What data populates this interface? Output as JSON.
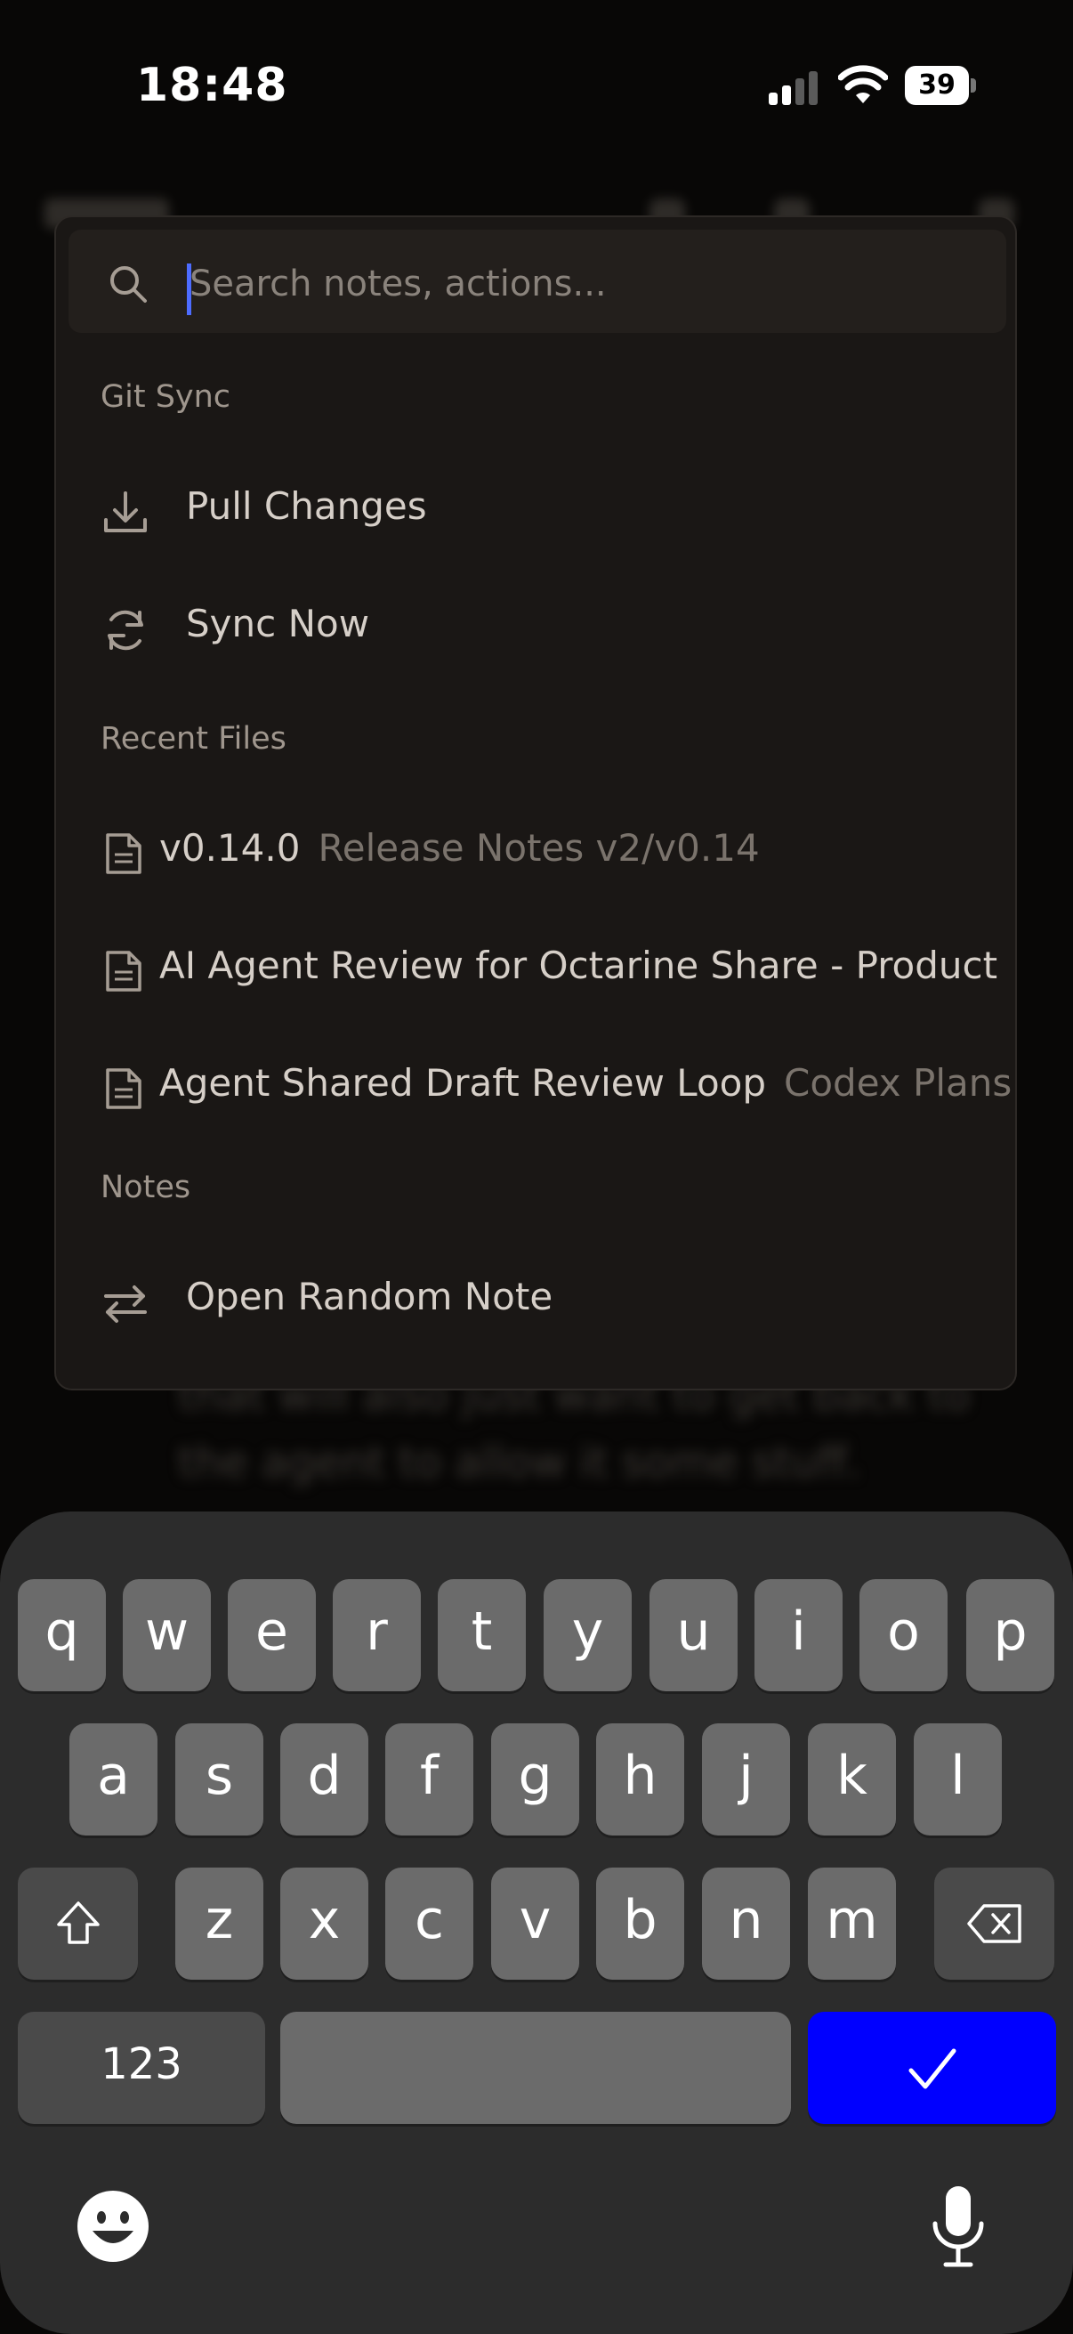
{
  "status_bar": {
    "time": "18:48",
    "battery": "39"
  },
  "search": {
    "placeholder": "Search notes, actions..."
  },
  "sections": {
    "git_sync": "Git Sync",
    "recent_files": "Recent Files",
    "notes": "Notes"
  },
  "git_sync_items": [
    {
      "label": "Pull Changes",
      "icon": "download-icon"
    },
    {
      "label": "Sync Now",
      "icon": "refresh-icon"
    }
  ],
  "recent_files": [
    {
      "title": "v0.14.0",
      "path": "Release Notes v2/v0.14"
    },
    {
      "title": "AI Agent Review for Octarine Share - Product",
      "path": ""
    },
    {
      "title": "Agent Shared Draft Review Loop",
      "path": "Codex Plans"
    }
  ],
  "notes_items": [
    {
      "label": "Open Random Note",
      "icon": "shuffle-arrows-icon"
    }
  ],
  "background": {
    "line1": "that will also just want to get back to",
    "line2": "the agent to allow it some stuff."
  },
  "keyboard": {
    "row1": [
      "q",
      "w",
      "e",
      "r",
      "t",
      "y",
      "u",
      "i",
      "o",
      "p"
    ],
    "row2": [
      "a",
      "s",
      "d",
      "f",
      "g",
      "h",
      "j",
      "k",
      "l"
    ],
    "row3": [
      "z",
      "x",
      "c",
      "v",
      "b",
      "n",
      "m"
    ],
    "numbers_label": "123",
    "done_color": "#0000ff"
  }
}
